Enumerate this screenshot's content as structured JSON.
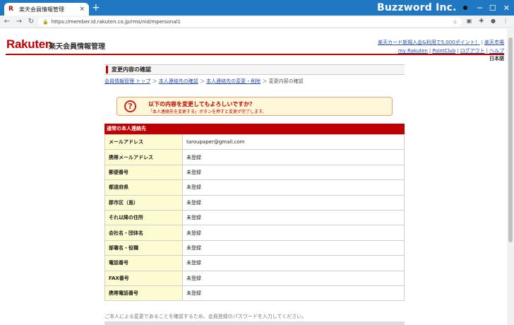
{
  "browser": {
    "tab_title": "楽天会員情報管理",
    "tab_favicon": "R",
    "tab_close": "×",
    "new_tab": "+",
    "window_title": "Buzzword Inc.",
    "url": "https://member.id.rakuten.co.jp/rms/nid/mpersonal1",
    "icons": [
      "back-icon",
      "forward-icon",
      "reload-icon",
      "lock-icon",
      "star-icon",
      "extension-icon",
      "puzzle-icon",
      "profile-icon",
      "menu-icon"
    ]
  },
  "header": {
    "logo": "Rakuten",
    "title": "楽天会員情報管理",
    "links": {
      "card": "楽天カード新規入会&利用で5,000ポイント！",
      "top": "楽天市場",
      "myrakuten": "my Rakuten",
      "pointclub": "PointClub",
      "logout": "ログアウト",
      "help": "ヘルプ"
    },
    "language": "日本語",
    "brand_color": "#bf0000"
  },
  "main": {
    "heading": "変更内容の確認",
    "breadcrumb": {
      "b1": "会員情報管理 トップ",
      "b2": "本人連絡先の確認",
      "b3": "本人連絡先の変更・削除",
      "current": "変更内容の確認"
    },
    "notice": {
      "title": "以下の内容を変更してもよろしいですか？",
      "subtitle": "「本人連絡先を変更する」ボタンを押すと変更が完了します。"
    },
    "section_title": "通常の本人連絡先",
    "rows": [
      {
        "label": "メールアドレス",
        "value": "taroupaper@gmail.com"
      },
      {
        "label": "携帯メールアドレス",
        "value": "未登録"
      },
      {
        "label": "郵便番号",
        "value": "未登録"
      },
      {
        "label": "都道府県",
        "value": "未登録"
      },
      {
        "label": "郡市区（島）",
        "value": "未登録"
      },
      {
        "label": "それ以降の住所",
        "value": "未登録"
      },
      {
        "label": "会社名・団体名",
        "value": "未登録"
      },
      {
        "label": "部署名・役職",
        "value": "未登録"
      },
      {
        "label": "電話番号",
        "value": "未登録"
      },
      {
        "label": "FAX番号",
        "value": "未登録"
      },
      {
        "label": "携帯電話番号",
        "value": "未登録"
      }
    ],
    "footnote": "ご本人による変更であることを確認するため、会員登録のパスワードを入力してください。"
  }
}
